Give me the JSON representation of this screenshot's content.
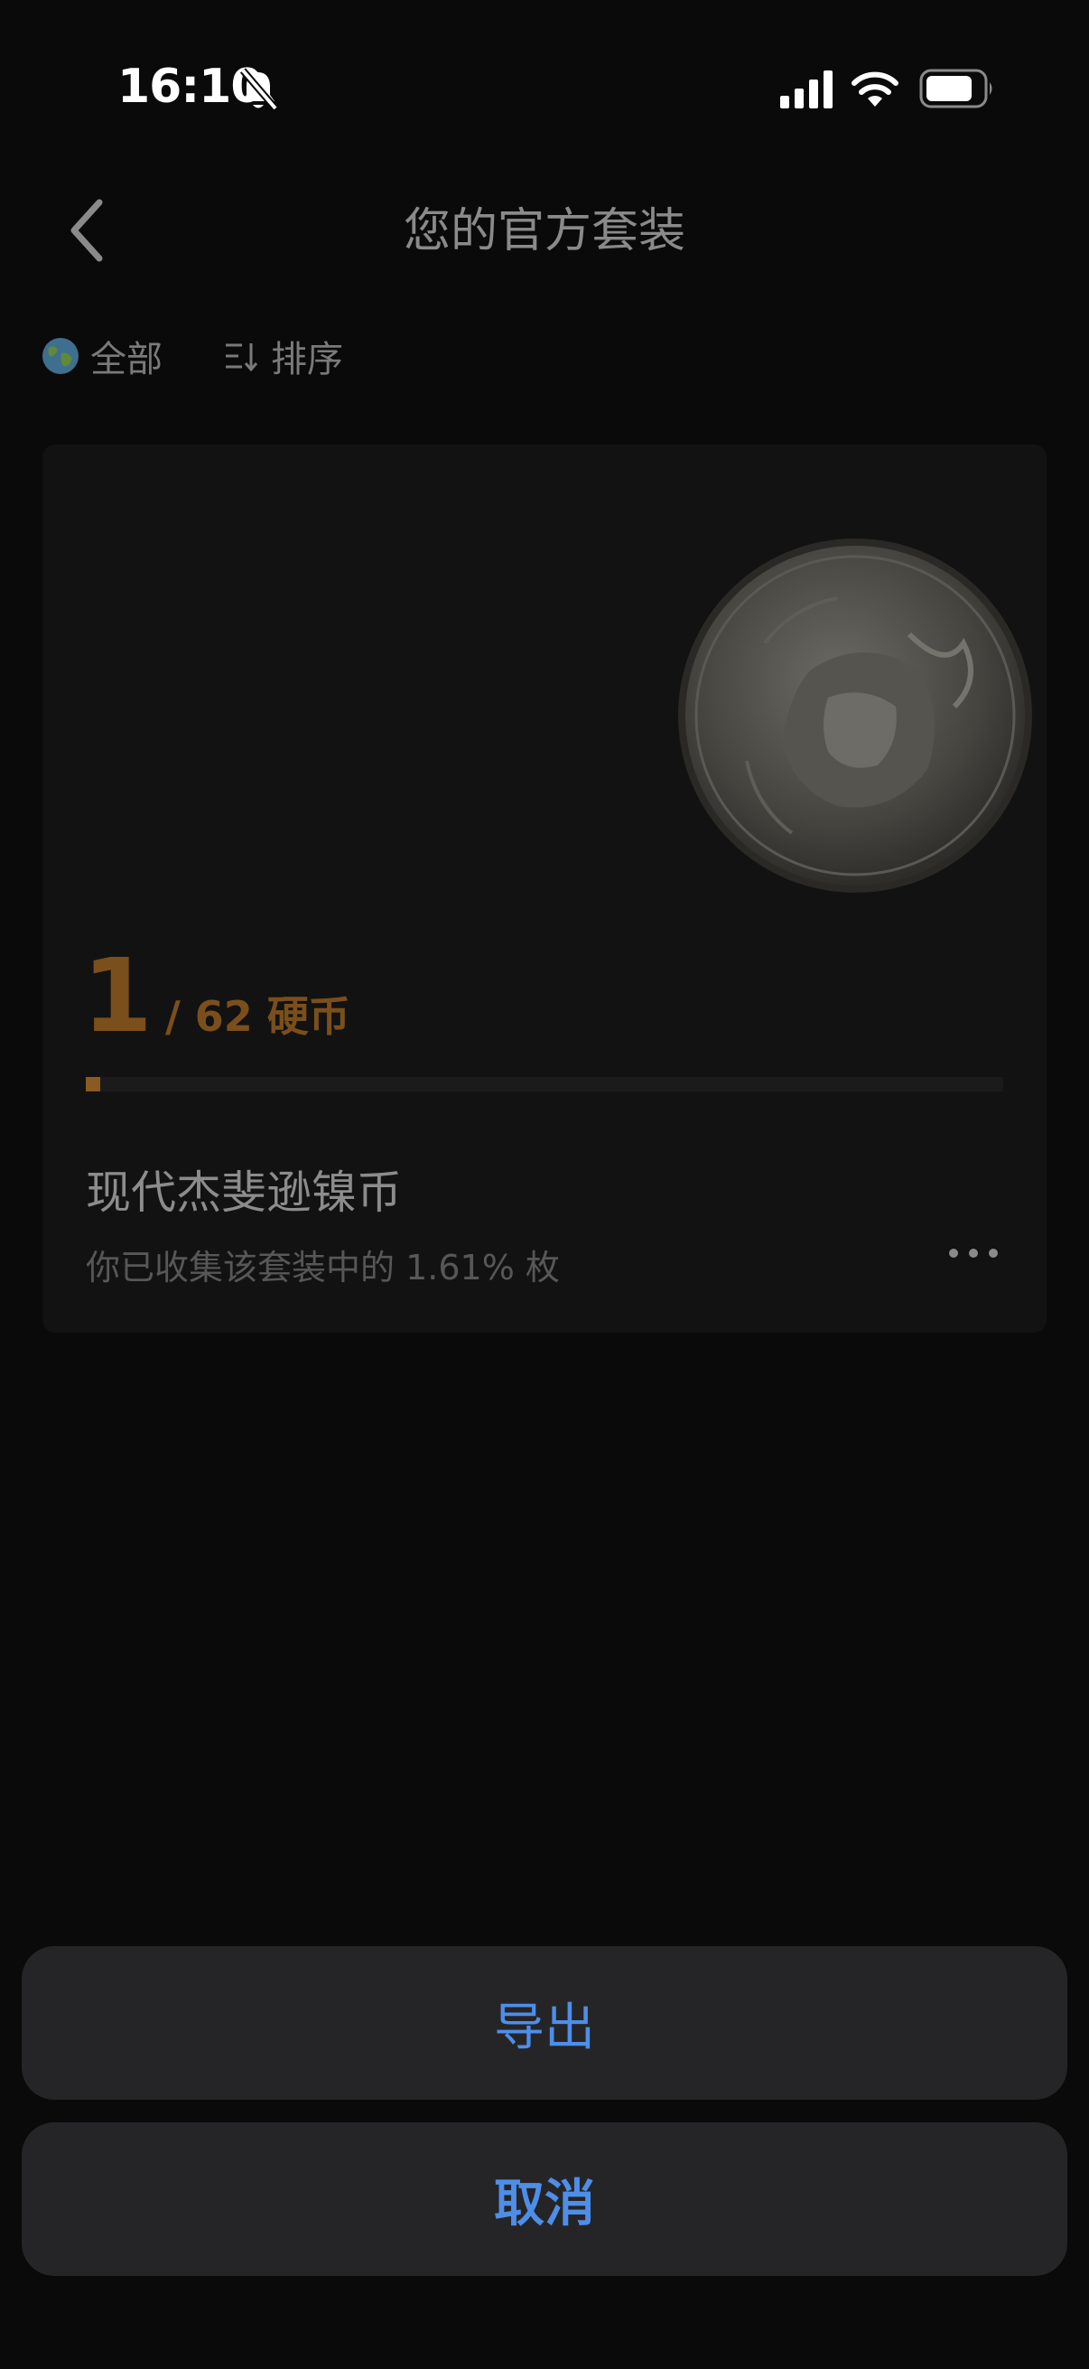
{
  "status_bar": {
    "time": "16:10",
    "icons": [
      "bell-slash-icon",
      "signal-icon",
      "wifi-icon",
      "battery-icon"
    ]
  },
  "header": {
    "title": "您的官方套装",
    "back_icon": "chevron-left-icon"
  },
  "filters": {
    "all_label": "全部",
    "all_icon": "globe-icon",
    "sort_label": "排序",
    "sort_icon": "sort-icon"
  },
  "set_card": {
    "collected_count": "1",
    "total_label": "/ 62 硬币",
    "progress_fraction": 0.0161,
    "name": "现代杰斐逊镍币",
    "description": "你已收集该套装中的 1.61% 枚",
    "coin_icon": "jefferson-nickel-coin-image",
    "more_icon": "more-horizontal-icon"
  },
  "action_sheet": {
    "export_label": "导出",
    "cancel_label": "取消"
  },
  "colors": {
    "background": "#0a0a0a",
    "card": "#121212",
    "accent_bronze": "#7a4f1c",
    "action_blue": "#4e8ee8",
    "sheet_button": "#252527"
  }
}
